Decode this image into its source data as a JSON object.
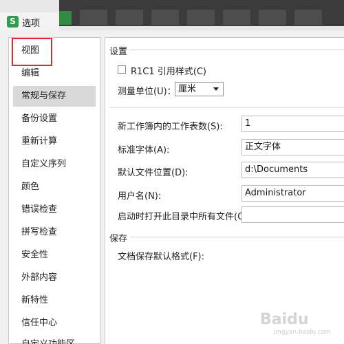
{
  "window": {
    "title": "选项",
    "app_icon": "S"
  },
  "sidebar": {
    "items": [
      {
        "label": "视图"
      },
      {
        "label": "编辑"
      },
      {
        "label": "常规与保存"
      },
      {
        "label": "备份设置"
      },
      {
        "label": "重新计算"
      },
      {
        "label": "自定义序列"
      },
      {
        "label": "颜色"
      },
      {
        "label": "错误检查"
      },
      {
        "label": "拼写检查"
      },
      {
        "label": "安全性"
      },
      {
        "label": "外部内容"
      },
      {
        "label": "新特性"
      },
      {
        "label": "信任中心"
      },
      {
        "label": "自定义功能区"
      }
    ],
    "selected": "常规与保存",
    "highlighted": "视图",
    "highlight_color": "#e0282e"
  },
  "settings": {
    "section_title": "设置",
    "r1c1_label": "R1C1 引用样式(C)",
    "r1c1_checked": false,
    "unit_label": "测量单位(U)：",
    "unit_value": "厘米",
    "sheet_count_label": "新工作簿内的工作表数(S):",
    "sheet_count_value": "1",
    "std_font_label": "标准字体(A):",
    "std_font_value": "正文字体",
    "default_path_label": "默认文件位置(D):",
    "default_path_value": "d:\\Documents",
    "username_label": "用户名(N):",
    "username_value": "Administrator",
    "startup_label": "启动时打开此目录中所有文件(O):",
    "startup_value": ""
  },
  "save": {
    "section_title": "保存",
    "default_format_label": "文档保存默认格式(F):"
  },
  "watermark": {
    "text": "Baidu",
    "sub": "jingyan.baidu.com"
  }
}
